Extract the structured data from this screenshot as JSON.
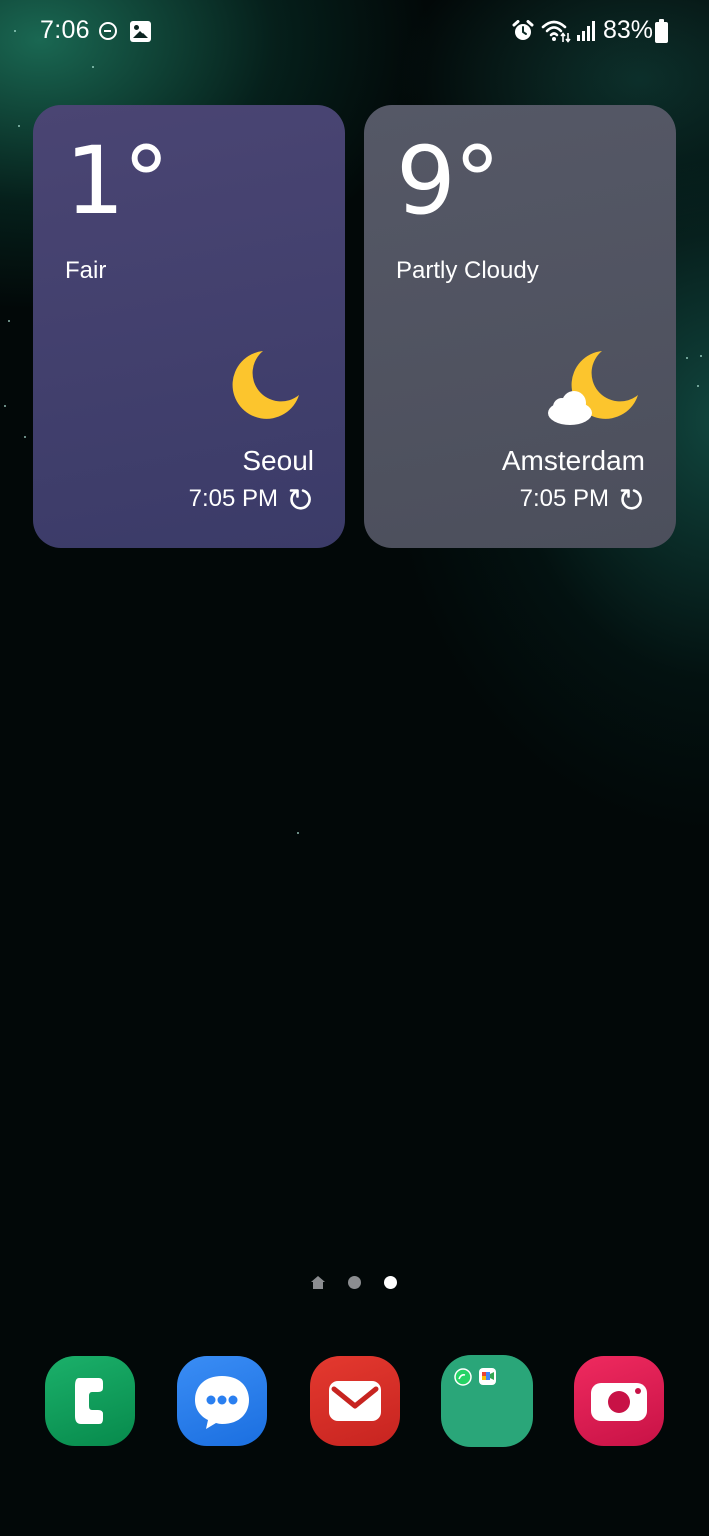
{
  "status_bar": {
    "time": "7:06",
    "battery_percent": "83%",
    "icons": [
      "do-not-disturb-icon",
      "gallery-icon",
      "alarm-icon",
      "wifi-icon",
      "signal-icon",
      "battery-icon"
    ]
  },
  "widgets": [
    {
      "temperature": "1°",
      "condition": "Fair",
      "city": "Seoul",
      "updated": "7:05 PM",
      "icon": "moon-icon",
      "background": "#413f6c"
    },
    {
      "temperature": "9°",
      "condition": "Partly Cloudy",
      "city": "Amsterdam",
      "updated": "7:05 PM",
      "icon": "moon-cloud-icon",
      "background": "#50535f"
    }
  ],
  "page_indicator": {
    "pages": 3,
    "current_page": 3,
    "active_color": "#ffffff",
    "inactive_color": "#8b8d90"
  },
  "dock": [
    {
      "app": "Phone",
      "icon": "phone-icon",
      "color": "#0a9e5a"
    },
    {
      "app": "Messages",
      "icon": "messages-icon",
      "color": "#2a7ff0"
    },
    {
      "app": "Email",
      "icon": "email-icon",
      "color": "#d72e27"
    },
    {
      "app": "Folder",
      "icon": "folder-icon",
      "color": "#2aa679"
    },
    {
      "app": "Camera",
      "icon": "camera-icon",
      "color": "#e01d53"
    }
  ],
  "colors": {
    "moon": "#fcc52d",
    "cloud": "#ffffff"
  }
}
